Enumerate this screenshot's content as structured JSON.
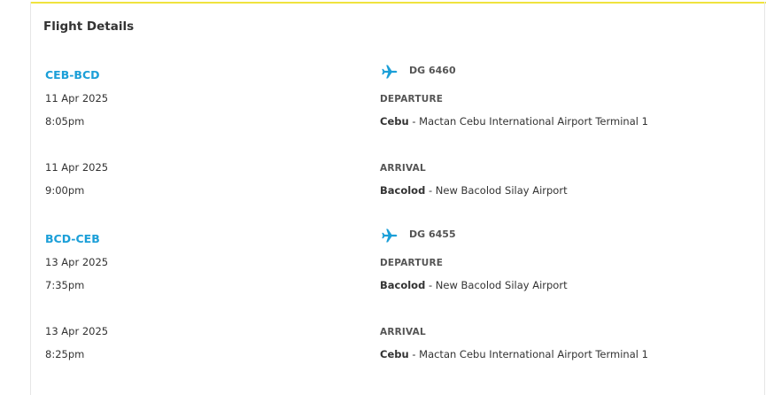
{
  "section_title": "Flight Details",
  "colors": {
    "accent": "#1b9fd8",
    "top_border": "#f0e33e",
    "text": "#333333"
  },
  "segments": [
    {
      "route": "CEB-BCD",
      "flight_icon": "airplane-icon",
      "flight_number": "DG 6460",
      "departure": {
        "label": "DEPARTURE",
        "date": "11 Apr 2025",
        "time": "8:05pm",
        "city": "Cebu",
        "separator": " - ",
        "airport": "Mactan Cebu International Airport Terminal 1"
      },
      "arrival": {
        "label": "ARRIVAL",
        "date": "11 Apr 2025",
        "time": "9:00pm",
        "city": "Bacolod",
        "separator": " - ",
        "airport": "New Bacolod Silay Airport"
      }
    },
    {
      "route": "BCD-CEB",
      "flight_icon": "airplane-icon",
      "flight_number": "DG 6455",
      "departure": {
        "label": "DEPARTURE",
        "date": "13 Apr 2025",
        "time": "7:35pm",
        "city": "Bacolod",
        "separator": " - ",
        "airport": "New Bacolod Silay Airport"
      },
      "arrival": {
        "label": "ARRIVAL",
        "date": "13 Apr 2025",
        "time": "8:25pm",
        "city": "Cebu",
        "separator": " - ",
        "airport": "Mactan Cebu International Airport Terminal 1"
      }
    }
  ]
}
